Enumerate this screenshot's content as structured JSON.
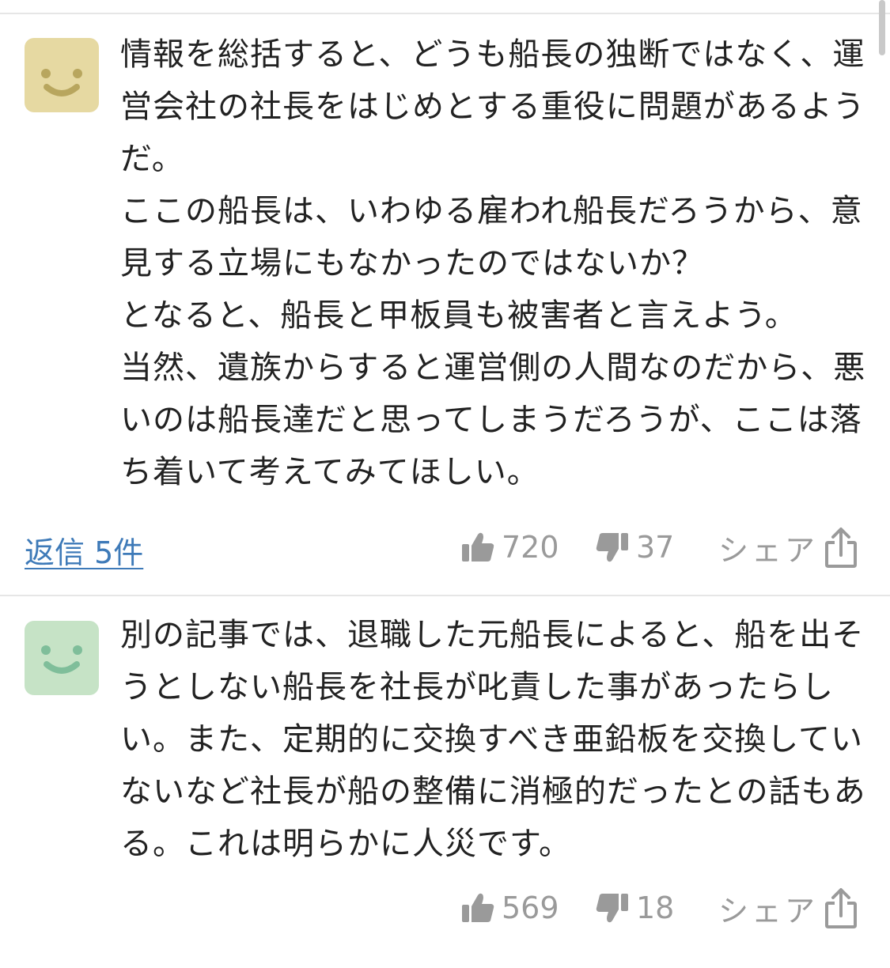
{
  "colors": {
    "link": "#3e7ab8",
    "meta": "#9a9a9a",
    "avatar_1": "#e6d9a2",
    "avatar_1_face": "#b8a65e",
    "avatar_2": "#c6e3c6",
    "avatar_2_face": "#7fbe9a"
  },
  "comments": [
    {
      "text": "情報を総括すると、どうも船長の独断ではなく、運営会社の社長をはじめとする重役に問題があるようだ。\nここの船長は、いわゆる雇われ船長だろうから、意見する立場にもなかったのではないか？\nとなると、船長と甲板員も被害者と言えよう。\n当然、遺族からすると運営側の人間なのだから、悪いのは船長達だと思ってしまうだろうが、ここは落ち着いて考えてみてほしい。",
      "reply_label": "返信 5件",
      "likes": "720",
      "dislikes": "37",
      "share_label": "シェア"
    },
    {
      "text": "別の記事では、退職した元船長によると、船を出そうとしない船長を社長が叱責した事があったらしい。また、定期的に交換すべき亜鉛板を交換していないなど社長が船の整備に消極的だったとの話もある。これは明らかに人災です。",
      "likes": "569",
      "dislikes": "18",
      "share_label": "シェア"
    }
  ]
}
